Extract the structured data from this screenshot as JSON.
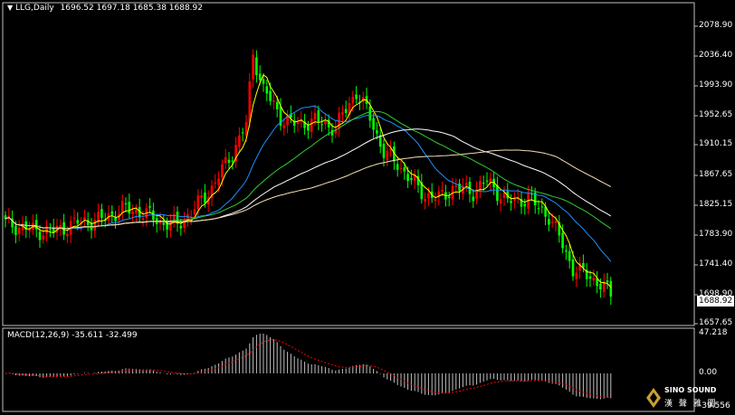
{
  "header": {
    "symbol_label": "LLG,Daily",
    "ohlc": "1696.52 1697.18 1685.38 1688.92"
  },
  "price_axis": {
    "ticks": [
      "2078.90",
      "2036.40",
      "1993.90",
      "1952.65",
      "1910.15",
      "1867.65",
      "1825.15",
      "1783.90",
      "1741.40",
      "1698.90",
      "1657.65"
    ],
    "current_price": "1688.92"
  },
  "macd": {
    "label": "MACD(12,26,9) -35.611 -32.499",
    "ticks": [
      "47.218",
      "0.00",
      "-39.556"
    ]
  },
  "watermark": {
    "brand": "SINO SOUND",
    "chinese": "漢 聲 雅 圖"
  },
  "colors": {
    "bull": "#ff0000",
    "bear": "#00ff00",
    "ma5": "#ffff00",
    "ma10": "#ffffff",
    "ma20": "#1e90ff",
    "ma60": "#32cd32",
    "ma120": "#ffffff",
    "ma250": "#f5deb3",
    "signal": "#ff0000",
    "histogram": "#c0c0c0"
  }
}
